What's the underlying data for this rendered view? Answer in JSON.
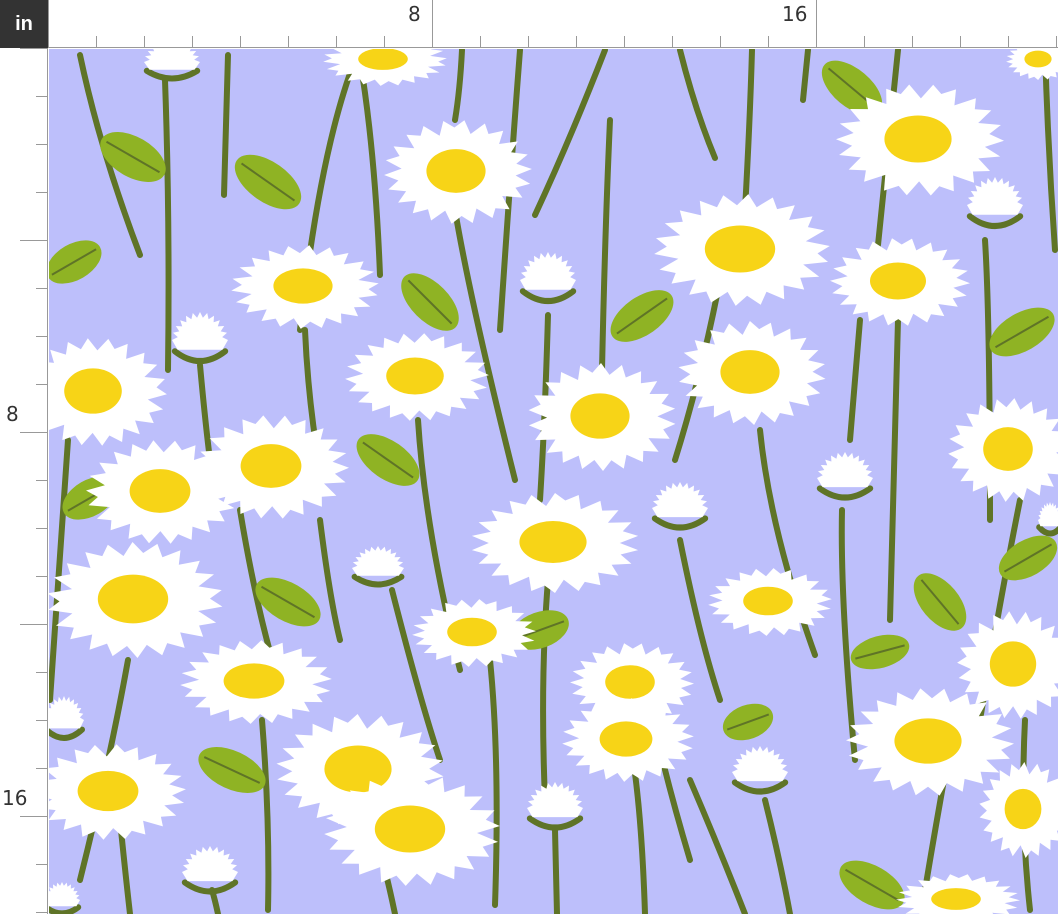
{
  "ruler": {
    "unit": "in",
    "top_labels": [
      "8",
      "16"
    ],
    "left_labels": [
      "8",
      "16"
    ]
  },
  "pattern": {
    "motif": "daisy-meadow",
    "colors": {
      "background": "#BDBFFB",
      "petal": "#FFFFFF",
      "center": "#F7D417",
      "stem": "#5F7427",
      "leaf": "#8FB324",
      "leaf_vein": "#5F7427",
      "ruler_dark": "#333333"
    }
  }
}
